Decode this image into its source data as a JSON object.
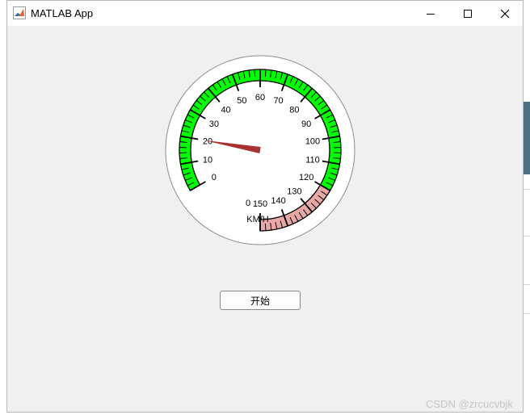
{
  "window": {
    "title": "MATLAB App"
  },
  "gauge": {
    "min": 0,
    "max": 150,
    "value": 20,
    "unit_label": "KM/H",
    "value_display": "0",
    "major_ticks": [
      0,
      10,
      20,
      30,
      40,
      50,
      60,
      70,
      80,
      90,
      100,
      110,
      120,
      130,
      140,
      150
    ],
    "scale_colors": [
      {
        "from": 0,
        "to": 120,
        "color": "#00ff00"
      },
      {
        "from": 120,
        "to": 150,
        "color": "#e8a8a8"
      }
    ],
    "needle_color": "#a83232"
  },
  "buttons": {
    "start_label": "开始"
  },
  "watermark": "CSDN @zrcucvbjk"
}
